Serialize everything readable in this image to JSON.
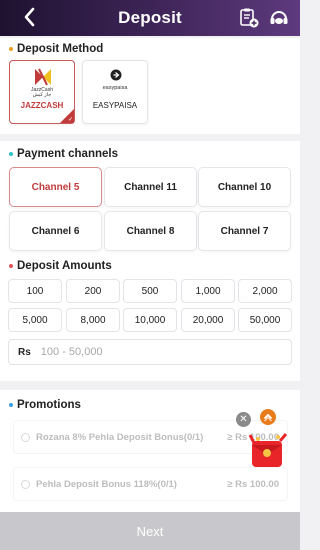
{
  "header": {
    "title": "Deposit",
    "back_icon": "back-arrow-icon",
    "record_icon": "clipboard-record-icon",
    "service_icon": "customer-service-icon"
  },
  "deposit_method": {
    "title": "Deposit Method",
    "dot_color": "#f0a020",
    "methods": [
      {
        "label": "JAZZCASH",
        "logo_text_1": "JazzCash",
        "logo_text_2": "جاز کیش",
        "selected": true,
        "color": "#c23b3b"
      },
      {
        "label": "EASYPAISA",
        "logo_text_1": "easypaisa",
        "selected": false,
        "color": "#222222"
      }
    ]
  },
  "payment_channels": {
    "title": "Payment channels",
    "dot_color": "#2ec4c4",
    "channels": [
      {
        "label": "Channel 5",
        "selected": true
      },
      {
        "label": "Channel 11",
        "selected": false
      },
      {
        "label": "Channel 10",
        "selected": false
      },
      {
        "label": "Channel 6",
        "selected": false
      },
      {
        "label": "Channel 8",
        "selected": false
      },
      {
        "label": "Channel 7",
        "selected": false
      }
    ]
  },
  "deposit_amounts": {
    "title": "Deposit Amounts",
    "dot_color": "#e05555",
    "amounts": [
      "100",
      "200",
      "500",
      "1,000",
      "2,000",
      "5,000",
      "8,000",
      "10,000",
      "20,000",
      "50,000"
    ],
    "currency": "Rs",
    "placeholder": "100 - 50,000"
  },
  "promotions": {
    "title": "Promotions",
    "dot_color": "#3aa0e0",
    "items": [
      {
        "label": "Rozana 8% Pehla Deposit Bonus(0/1)",
        "amount": "≥ Rs 100.00"
      },
      {
        "label": "Pehla Deposit Bonus 118%(0/1)",
        "amount": "≥ Rs 100.00"
      }
    ]
  },
  "floating": {
    "close_icon": "close-icon",
    "up_icon": "chevron-up-icon",
    "gift_icon": "red-envelope-gift-icon"
  },
  "next_button": {
    "label": "Next"
  }
}
